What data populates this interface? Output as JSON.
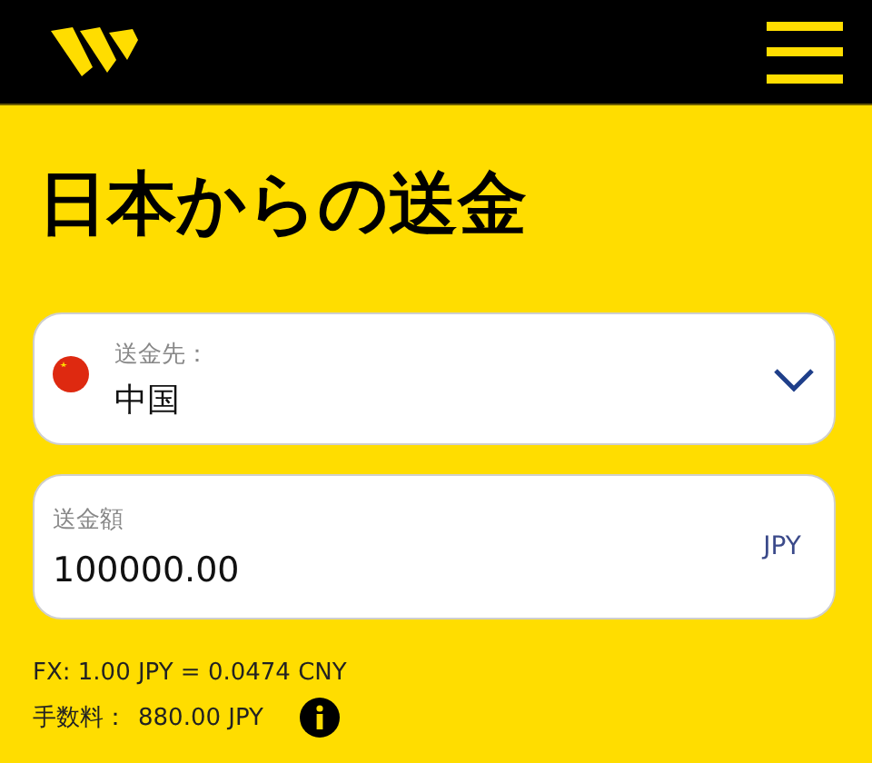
{
  "title": "日本からの送金",
  "destination": {
    "label": "送金先：",
    "value": "中国"
  },
  "amount": {
    "label": "送金額",
    "value": "100000.00",
    "currency": "JPY"
  },
  "fx": "FX: 1.00 JPY = 0.0474 CNY",
  "fee": {
    "label": "手数料：",
    "value": "880.00 JPY"
  }
}
